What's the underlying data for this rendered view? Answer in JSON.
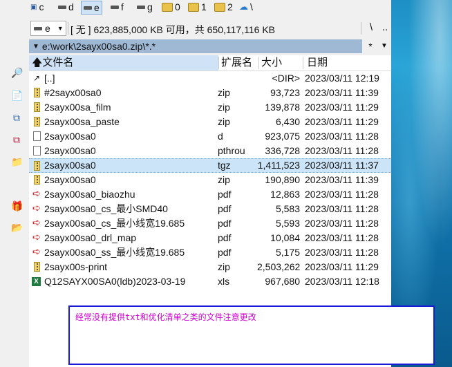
{
  "drives": [
    {
      "letter": "c",
      "icon": "network-drive-icon",
      "selected": false
    },
    {
      "letter": "d",
      "icon": "drive-icon",
      "selected": false
    },
    {
      "letter": "e",
      "icon": "drive-icon",
      "selected": true
    },
    {
      "letter": "f",
      "icon": "drive-icon",
      "selected": false
    },
    {
      "letter": "g",
      "icon": "drive-icon",
      "selected": false
    },
    {
      "letter": "0",
      "icon": "folder-icon",
      "selected": false
    },
    {
      "letter": "1",
      "icon": "folder-icon",
      "selected": false
    },
    {
      "letter": "2",
      "icon": "folder-icon",
      "selected": false
    },
    {
      "letter": "\\",
      "icon": "share-icon",
      "selected": false
    }
  ],
  "drive_info": {
    "current_drive": "e",
    "free_space_text": "[ 无 ]  623,885,000 KB 可用，共 650,117,116 KB",
    "root_button": "\\",
    "up_button": ".."
  },
  "path": {
    "text": "e:\\work\\2sayx00sa0.zip\\*.*",
    "history_button": "*",
    "favorites_button": "▼"
  },
  "columns": {
    "name": "文件名",
    "ext": "扩展名",
    "size": "大小",
    "date": "日期"
  },
  "files": [
    {
      "icon": "up",
      "name": "[..]",
      "ext": "",
      "size": "<DIR>",
      "date": "2023/03/11 12:19",
      "selected": false
    },
    {
      "icon": "zip",
      "name": "#2sayx00sa0",
      "ext": "zip",
      "size": "93,723",
      "date": "2023/03/11 11:39",
      "selected": false
    },
    {
      "icon": "zip",
      "name": "2sayx00sa_film",
      "ext": "zip",
      "size": "139,878",
      "date": "2023/03/11 11:29",
      "selected": false
    },
    {
      "icon": "zip",
      "name": "2sayx00sa_paste",
      "ext": "zip",
      "size": "6,430",
      "date": "2023/03/11 11:29",
      "selected": false
    },
    {
      "icon": "file",
      "name": "2sayx00sa0",
      "ext": "d",
      "size": "923,075",
      "date": "2023/03/11 11:28",
      "selected": false
    },
    {
      "icon": "file",
      "name": "2sayx00sa0",
      "ext": "pthrou",
      "size": "336,728",
      "date": "2023/03/11 11:28",
      "selected": false
    },
    {
      "icon": "zip",
      "name": "2sayx00sa0",
      "ext": "tgz",
      "size": "1,411,523",
      "date": "2023/03/11 11:37",
      "selected": true
    },
    {
      "icon": "zip",
      "name": "2sayx00sa0",
      "ext": "zip",
      "size": "190,890",
      "date": "2023/03/11 11:39",
      "selected": false
    },
    {
      "icon": "pdf",
      "name": "2sayx00sa0_biaozhu",
      "ext": "pdf",
      "size": "12,863",
      "date": "2023/03/11 11:28",
      "selected": false
    },
    {
      "icon": "pdf",
      "name": "2sayx00sa0_cs_最小SMD40",
      "ext": "pdf",
      "size": "5,583",
      "date": "2023/03/11 11:28",
      "selected": false
    },
    {
      "icon": "pdf",
      "name": "2sayx00sa0_cs_最小线宽19.685",
      "ext": "pdf",
      "size": "5,593",
      "date": "2023/03/11 11:28",
      "selected": false
    },
    {
      "icon": "pdf",
      "name": "2sayx00sa0_drl_map",
      "ext": "pdf",
      "size": "10,084",
      "date": "2023/03/11 11:28",
      "selected": false
    },
    {
      "icon": "pdf",
      "name": "2sayx00sa0_ss_最小线宽19.685",
      "ext": "pdf",
      "size": "5,175",
      "date": "2023/03/11 11:28",
      "selected": false
    },
    {
      "icon": "zip",
      "name": "2sayx00s-print",
      "ext": "zip",
      "size": "2,503,262",
      "date": "2023/03/11 11:29",
      "selected": false
    },
    {
      "icon": "xls",
      "name": "Q12SAYX00SA0(ldb)2023-03-19",
      "ext": "xls",
      "size": "967,680",
      "date": "2023/03/11 12:18",
      "selected": false
    }
  ],
  "note": {
    "text": "经常没有提供txt和优化清单之类的文件注意更改",
    "color": "#d000d0",
    "border_color": "#1a1ad6"
  },
  "left_toolbar": [
    "find-icon",
    "find-in-files-icon",
    "copy-files-icon",
    "compare-icon",
    "folder-icon",
    "package-icon",
    "new-folder-icon"
  ]
}
